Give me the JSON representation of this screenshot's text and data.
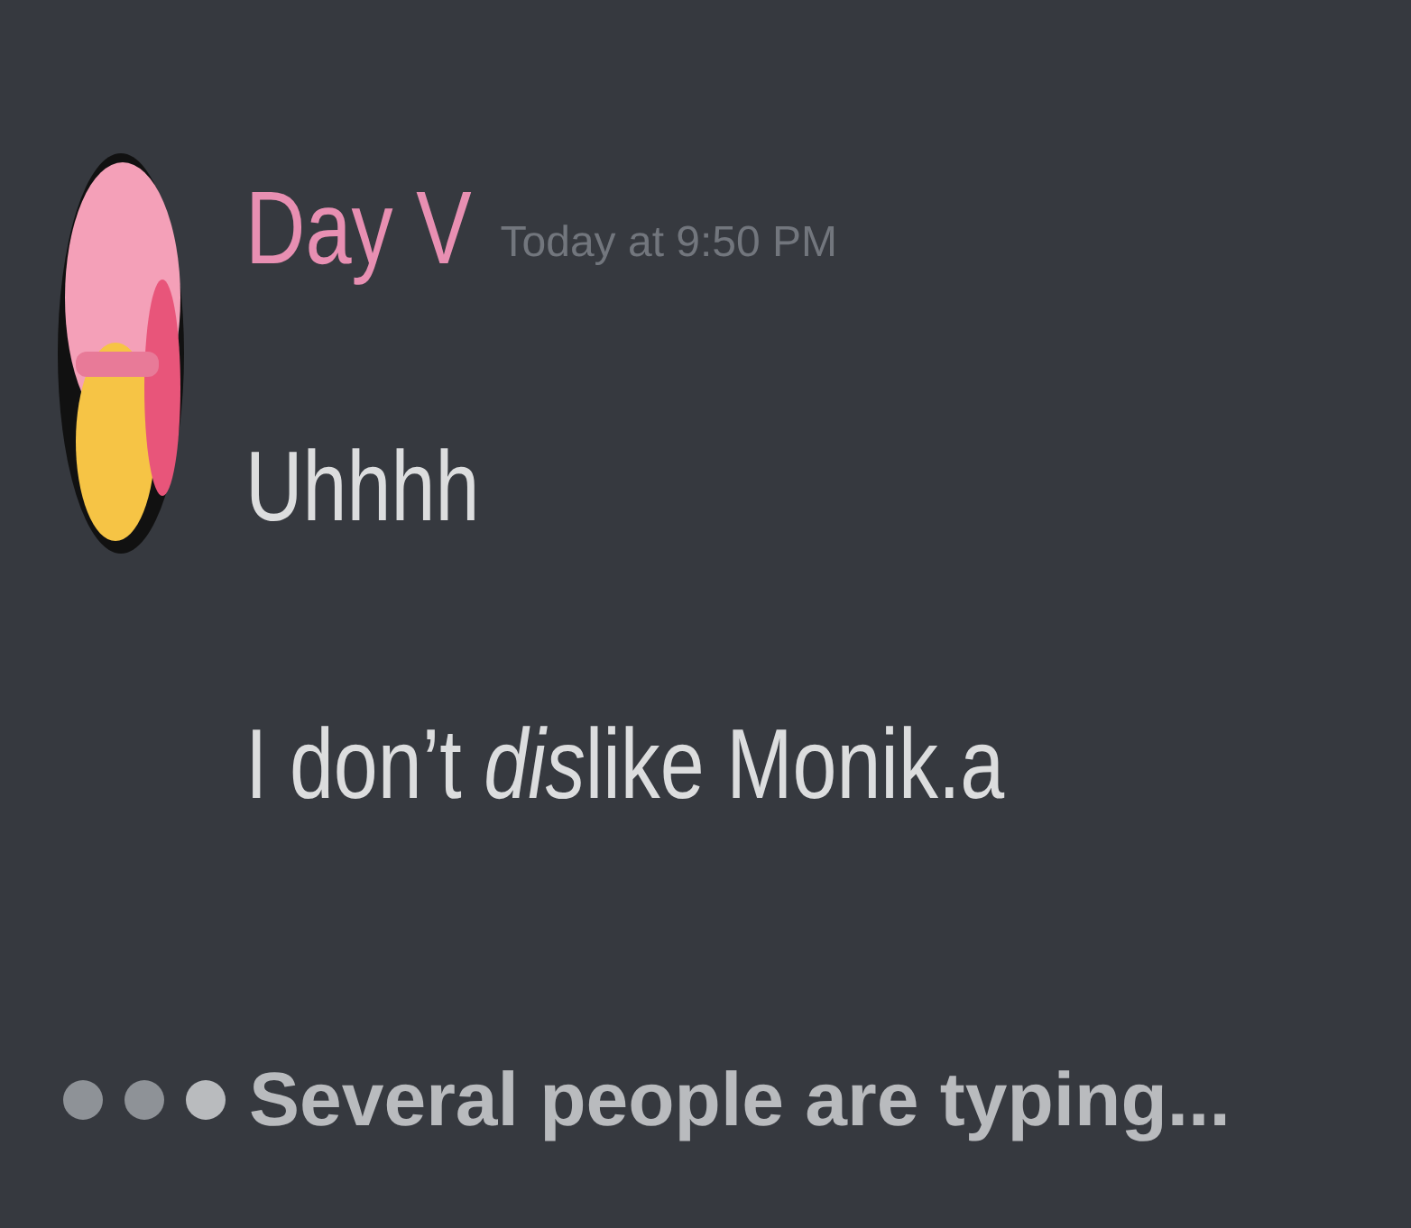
{
  "message": {
    "author": "Day V",
    "timestamp": "Today at 9:50 PM",
    "lines": [
      [
        {
          "text": "Uhhhh",
          "italic": false
        }
      ],
      [
        {
          "text": "I don’t ",
          "italic": false
        },
        {
          "text": "dis",
          "italic": true
        },
        {
          "text": "like Monik.a",
          "italic": false
        }
      ]
    ]
  },
  "typing_indicator": {
    "text": "Several people are typing..."
  }
}
